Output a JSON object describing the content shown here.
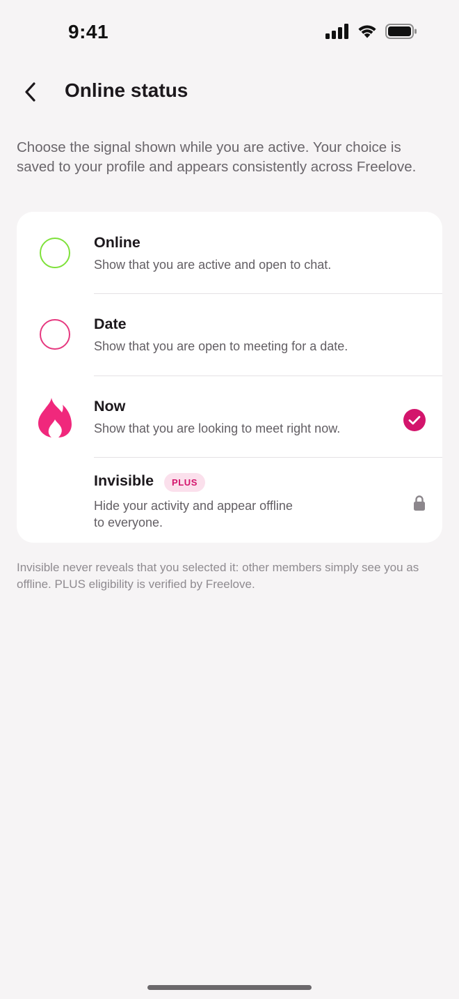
{
  "status_bar": {
    "time": "9:41",
    "icons": [
      "signal-icon",
      "wifi-icon",
      "battery-icon"
    ]
  },
  "header": {
    "back_icon": "chevron-left-icon",
    "title": "Online status"
  },
  "intro": "Choose the signal shown while you are active. Your choice is saved to your profile and appears consistently across Freelove.",
  "options": [
    {
      "name": "Online",
      "description": "Show that you are active and open to chat.",
      "icon": "green-ring-icon",
      "selected": false
    },
    {
      "name": "Date",
      "description": "Show that you are open to meeting for a date.",
      "icon": "pink-ring-icon",
      "selected": false
    },
    {
      "name": "Now",
      "description": "Show that you are looking to meet right now.",
      "icon": "flame-icon",
      "selected": true
    },
    {
      "name": "Invisible",
      "badge": "PLUS",
      "description_line1": "Hide your activity and appear offline",
      "description_line2": "to everyone.",
      "icon": "lock-icon",
      "locked": true
    }
  ],
  "footnote": "Invisible never reveals that you selected it: other members simply see you as offline. PLUS eligibility is verified by Freelove.",
  "colors": {
    "accent": "#d3156c",
    "online_green": "#7ee13a",
    "date_pink": "#e6387f",
    "flame": "#f0287c",
    "badge_bg": "#fbe0ec",
    "background": "#f6f4f5"
  }
}
